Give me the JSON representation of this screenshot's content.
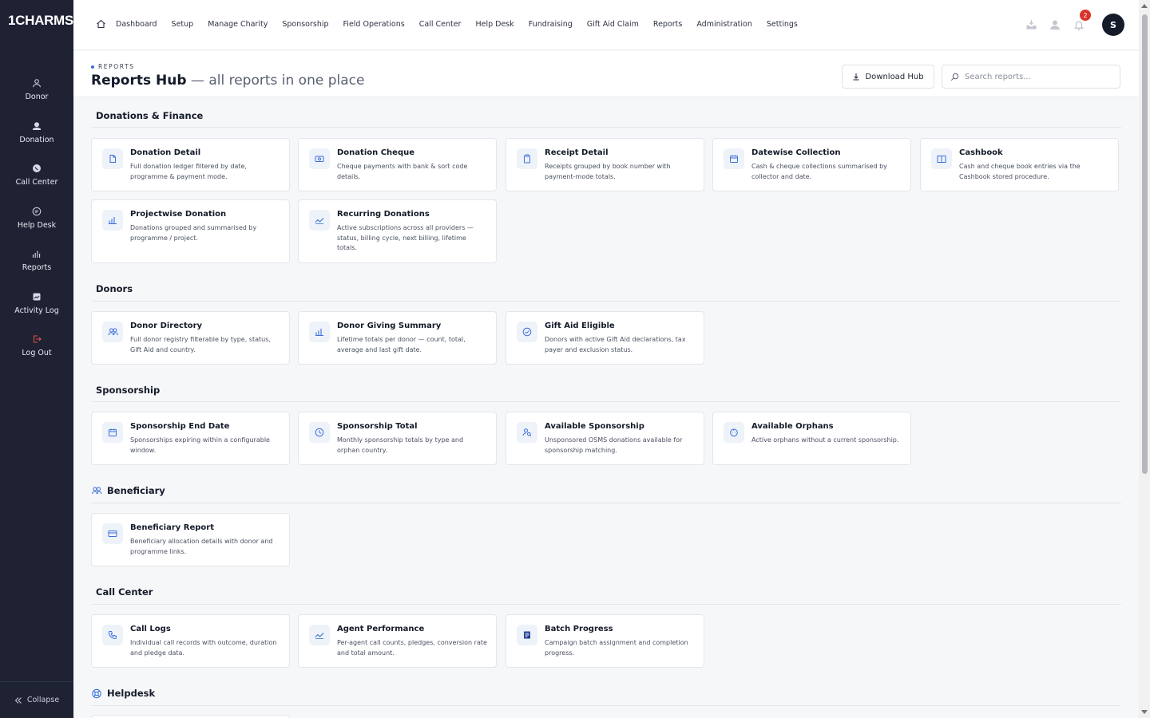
{
  "app": {
    "logo": "1CHARMS"
  },
  "sidebar": {
    "items": [
      {
        "label": "Donor",
        "icon": "person-icon"
      },
      {
        "label": "Donation",
        "icon": "donation-icon"
      },
      {
        "label": "Call Center",
        "icon": "phone-icon"
      },
      {
        "label": "Help Desk",
        "icon": "chat-icon"
      },
      {
        "label": "Reports",
        "icon": "bar-chart-icon"
      },
      {
        "label": "Activity Log",
        "icon": "log-icon"
      },
      {
        "label": "Log Out",
        "icon": "logout-icon"
      }
    ],
    "collapse_label": "Collapse"
  },
  "topnav": {
    "items": [
      "Dashboard",
      "Setup",
      "Manage Charity",
      "Sponsorship",
      "Field Operations",
      "Call Center",
      "Help Desk",
      "Fundraising",
      "Gift Aid Claim",
      "Reports",
      "Administration",
      "Settings"
    ],
    "notification_count": "2",
    "avatar_initial": "S"
  },
  "header": {
    "eyebrow": "REPORTS",
    "title": "Reports Hub",
    "subtitle": "— all reports in one place",
    "download_label": "Download Hub",
    "search_placeholder": "Search reports..."
  },
  "sections": [
    {
      "title": "Donations & Finance",
      "cards": [
        {
          "title": "Donation Detail",
          "desc": "Full donation ledger filtered by date, programme & payment mode.",
          "icon": "document-icon"
        },
        {
          "title": "Donation Cheque",
          "desc": "Cheque payments with bank & sort code details.",
          "icon": "cheque-icon"
        },
        {
          "title": "Receipt Detail",
          "desc": "Receipts grouped by book number with payment-mode totals.",
          "icon": "clipboard-icon"
        },
        {
          "title": "Datewise Collection",
          "desc": "Cash & cheque collections summarised by collector and date.",
          "icon": "calendar-icon"
        },
        {
          "title": "Cashbook",
          "desc": "Cash and cheque book entries via the Cashbook stored procedure.",
          "icon": "book-icon"
        },
        {
          "title": "Projectwise Donation",
          "desc": "Donations grouped and summarised by programme / project.",
          "icon": "bar-chart-icon"
        },
        {
          "title": "Recurring Donations",
          "desc": "Active subscriptions across all providers — status, billing cycle, next billing, lifetime totals.",
          "icon": "trend-icon"
        }
      ]
    },
    {
      "title": "Donors",
      "cards": [
        {
          "title": "Donor Directory",
          "desc": "Full donor registry filterable by type, status, Gift Aid and country.",
          "icon": "people-icon"
        },
        {
          "title": "Donor Giving Summary",
          "desc": "Lifetime totals per donor — count, total, average and last gift date.",
          "icon": "bar-chart-icon"
        },
        {
          "title": "Gift Aid Eligible",
          "desc": "Donors with active Gift Aid declarations, tax payer and exclusion status.",
          "icon": "check-circle-icon"
        }
      ]
    },
    {
      "title": "Sponsorship",
      "cards": [
        {
          "title": "Sponsorship End Date",
          "desc": "Sponsorships expiring within a configurable window.",
          "icon": "calendar-icon"
        },
        {
          "title": "Sponsorship Total",
          "desc": "Monthly sponsorship totals by type and orphan country.",
          "icon": "clock-icon"
        },
        {
          "title": "Available Sponsorship",
          "desc": "Unsponsored OSMS donations available for sponsorship matching.",
          "icon": "user-search-icon"
        },
        {
          "title": "Available Orphans",
          "desc": "Active orphans without a current sponsorship.",
          "icon": "child-icon"
        }
      ]
    },
    {
      "title": "Beneficiary",
      "title_icon": "people-icon",
      "cards": [
        {
          "title": "Beneficiary Report",
          "desc": "Beneficiary allocation details with donor and programme links.",
          "icon": "card-icon"
        }
      ]
    },
    {
      "title": "Call Center",
      "cards": [
        {
          "title": "Call Logs",
          "desc": "Individual call records with outcome, duration and pledge data.",
          "icon": "phone-icon"
        },
        {
          "title": "Agent Performance",
          "desc": "Per-agent call counts, pledges, conversion rate and total amount.",
          "icon": "trend-icon"
        },
        {
          "title": "Batch Progress",
          "desc": "Campaign batch assignment and completion progress.",
          "icon": "list-icon"
        }
      ]
    },
    {
      "title": "Helpdesk",
      "title_icon": "lifebuoy-icon",
      "cards": []
    }
  ]
}
